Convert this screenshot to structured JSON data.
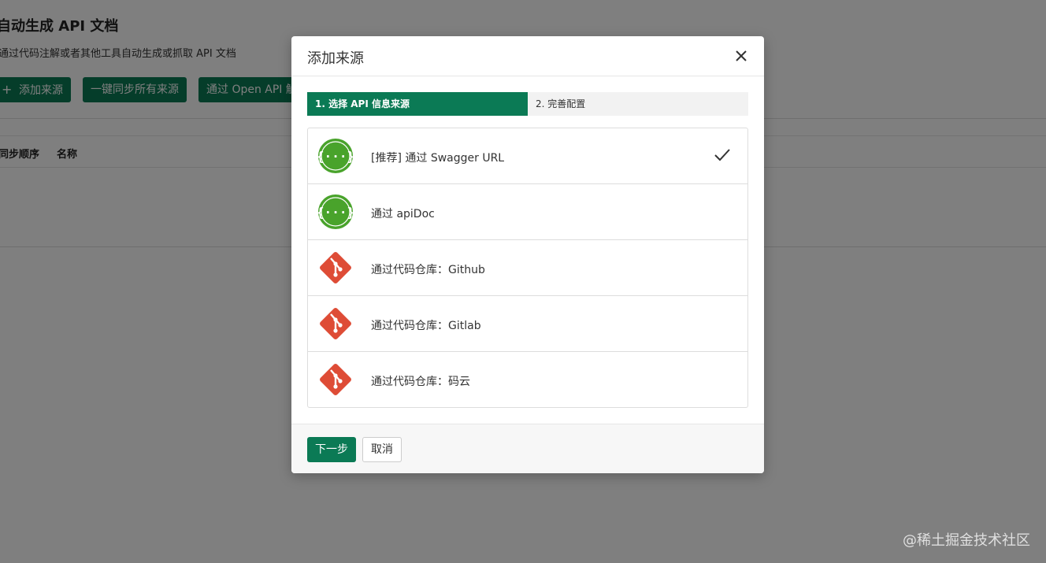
{
  "page": {
    "title": "自动生成 API 文档",
    "description": "通过代码注解或者其他工具自动生成或抓取 API 文档",
    "actions": {
      "add_source": "添加来源",
      "sync_all": "一键同步所有来源",
      "openapi": "通过 Open API 触发"
    },
    "table": {
      "columns": [
        "同步顺序",
        "名称"
      ]
    }
  },
  "modal": {
    "title": "添加来源",
    "steps": [
      {
        "label": "1. 选择 API 信息来源",
        "active": true
      },
      {
        "label": "2. 完善配置",
        "active": false
      }
    ],
    "sources": [
      {
        "label": "[推荐] 通过 Swagger URL",
        "icon": "swagger-icon",
        "selected": true
      },
      {
        "label": "通过 apiDoc",
        "icon": "swagger-icon",
        "selected": false
      },
      {
        "label": "通过代码仓库：Github",
        "icon": "git-icon",
        "selected": false
      },
      {
        "label": "通过代码仓库：Gitlab",
        "icon": "git-icon",
        "selected": false
      },
      {
        "label": "通过代码仓库：码云",
        "icon": "git-icon",
        "selected": false
      }
    ],
    "buttons": {
      "next": "下一步",
      "cancel": "取消"
    }
  },
  "watermark": "@稀土掘金技术社区",
  "colors": {
    "primary": "#0b7a55",
    "swagger": "#49a32b",
    "git": "#de4c36"
  }
}
